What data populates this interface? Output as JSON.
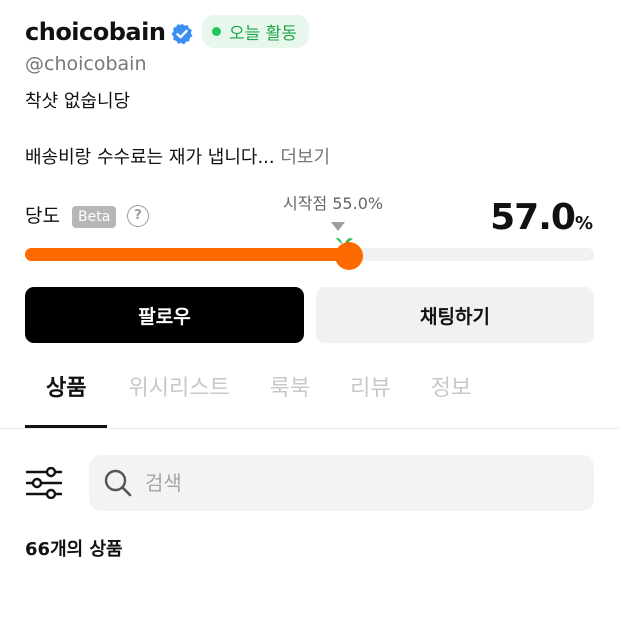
{
  "profile": {
    "name": "choicobain",
    "handle": "@choicobain",
    "active_label": "오늘 활동",
    "bio": "착샷 없숩니당",
    "notice": "배송비랑 수수료는 재가 냅니다...",
    "more_label": "더보기"
  },
  "sweetness": {
    "label": "당도",
    "beta_label": "Beta",
    "help_symbol": "?",
    "start_label": "시작점 55.0%",
    "start_value": 55.0,
    "value_text": "57.0",
    "value_unit": "%",
    "value": 57.0
  },
  "actions": {
    "follow_label": "팔로우",
    "chat_label": "채팅하기"
  },
  "tabs": [
    {
      "label": "상품",
      "active": true
    },
    {
      "label": "위시리스트",
      "active": false
    },
    {
      "label": "룩북",
      "active": false
    },
    {
      "label": "리뷰",
      "active": false
    },
    {
      "label": "정보",
      "active": false
    }
  ],
  "search": {
    "placeholder": "검색"
  },
  "products": {
    "count": "66",
    "count_suffix": "개의 상품"
  },
  "colors": {
    "accent": "#ff6a00",
    "active_green": "#22c55e",
    "verified_blue": "#3b8ff3"
  }
}
